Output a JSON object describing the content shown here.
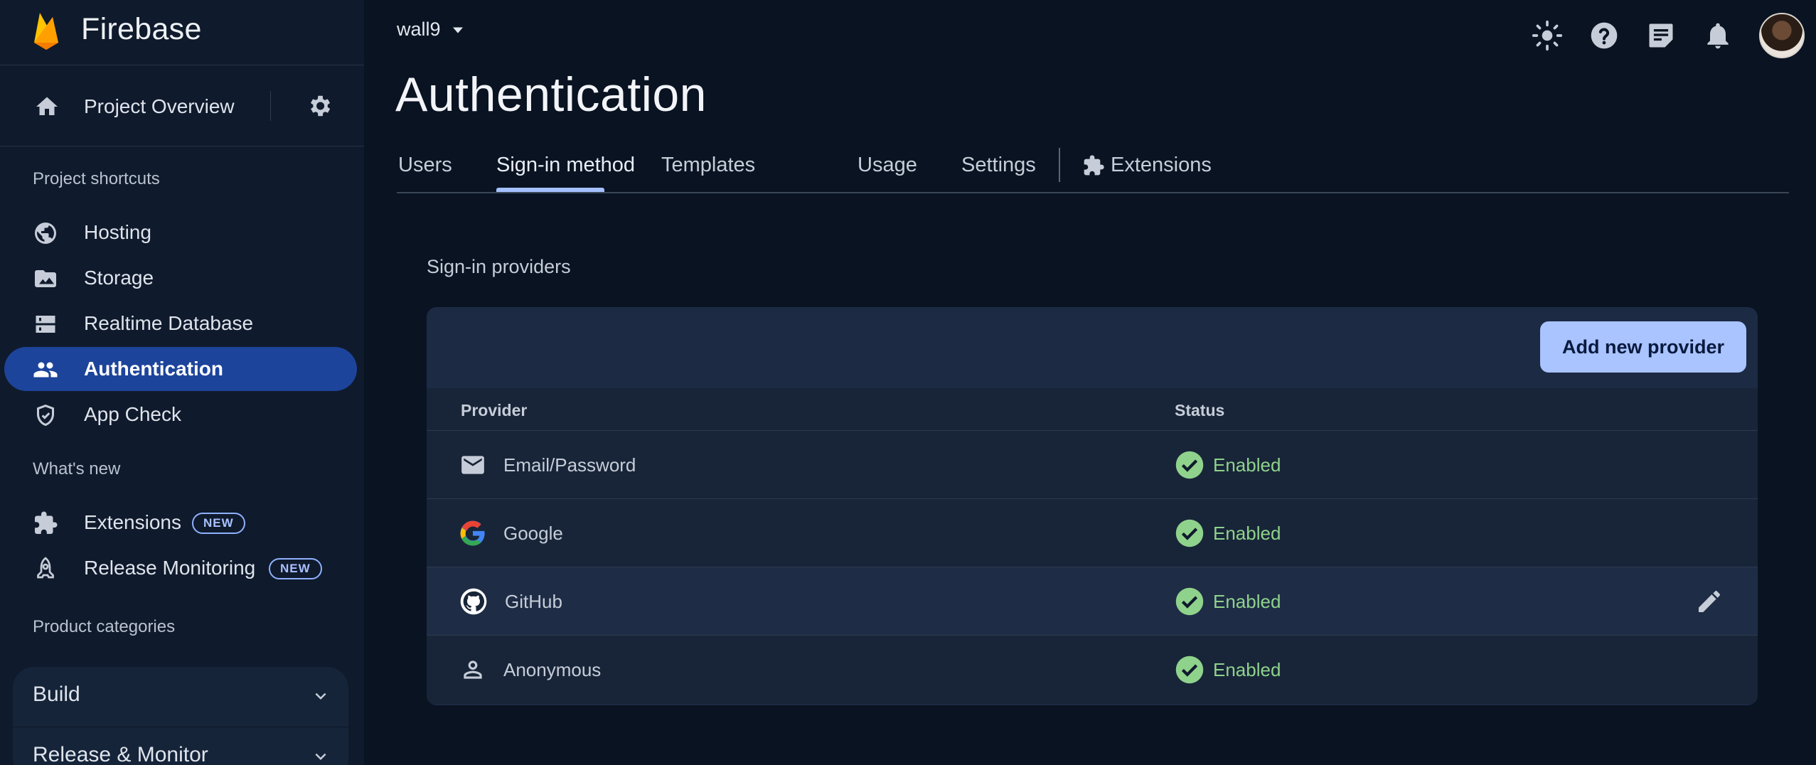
{
  "brand": {
    "name": "Firebase"
  },
  "sidebar": {
    "overview_label": "Project Overview",
    "shortcuts_heading": "Project shortcuts",
    "shortcuts": [
      {
        "label": "Hosting",
        "icon": "globe-icon"
      },
      {
        "label": "Storage",
        "icon": "folder-image-icon"
      },
      {
        "label": "Realtime Database",
        "icon": "database-icon"
      },
      {
        "label": "Authentication",
        "icon": "people-icon",
        "active": true
      },
      {
        "label": "App Check",
        "icon": "shield-check-icon"
      }
    ],
    "whats_new_heading": "What's new",
    "whats_new": [
      {
        "label": "Extensions",
        "icon": "puzzle-icon",
        "badge": "NEW"
      },
      {
        "label": "Release Monitoring",
        "icon": "rocket-icon",
        "badge": "NEW"
      }
    ],
    "categories_heading": "Product categories",
    "categories": [
      {
        "label": "Build"
      },
      {
        "label": "Release & Monitor"
      }
    ]
  },
  "header": {
    "project": "wall9",
    "title": "Authentication",
    "icons": [
      "theme-sun-icon",
      "help-icon",
      "feedback-icon",
      "notifications-icon",
      "avatar"
    ]
  },
  "tabs": [
    {
      "label": "Users"
    },
    {
      "label": "Sign-in method",
      "active": true
    },
    {
      "label": "Templates"
    },
    {
      "label": "Usage"
    },
    {
      "label": "Settings"
    },
    {
      "label": "Extensions",
      "icon": "puzzle-icon"
    }
  ],
  "providers": {
    "heading": "Sign-in providers",
    "add_button": "Add new provider",
    "columns": [
      "Provider",
      "Status"
    ],
    "rows": [
      {
        "name": "Email/Password",
        "icon": "email-icon",
        "status": "Enabled"
      },
      {
        "name": "Google",
        "icon": "google-icon",
        "status": "Enabled"
      },
      {
        "name": "GitHub",
        "icon": "github-icon",
        "status": "Enabled",
        "hovered": true
      },
      {
        "name": "Anonymous",
        "icon": "person-icon",
        "status": "Enabled"
      }
    ]
  },
  "colors": {
    "accent": "#1d449b",
    "button": "#a9c4ff",
    "status_enabled": "#8fd28c",
    "background": "#091322"
  }
}
